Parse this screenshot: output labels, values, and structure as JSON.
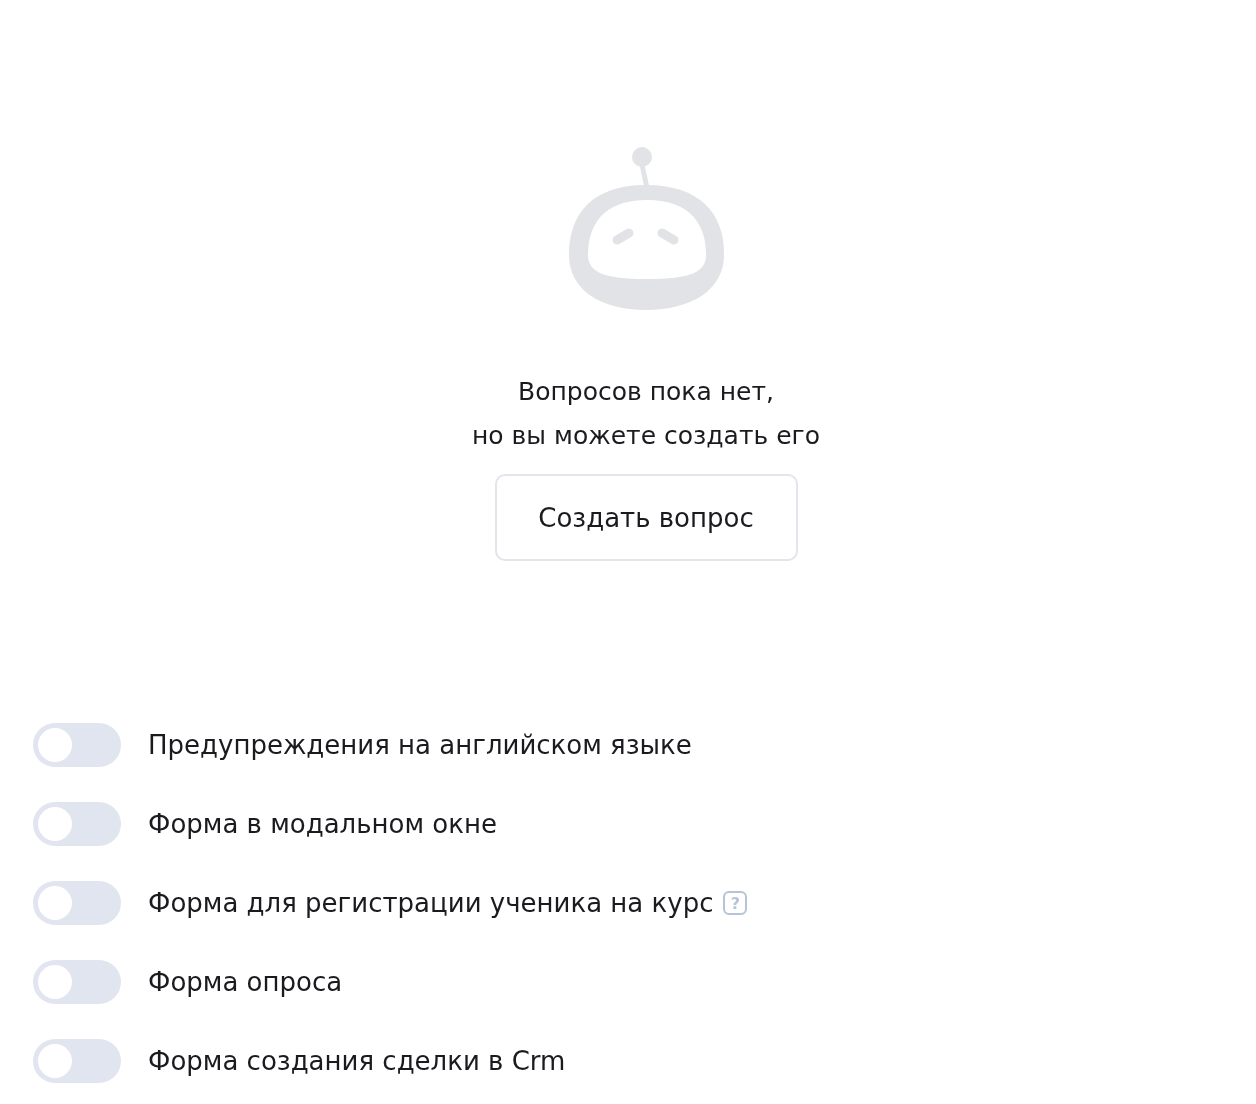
{
  "empty_state": {
    "message_lines": [
      "Вопросов пока нет,",
      "но вы можете создать его"
    ],
    "button": "Создать вопрос"
  },
  "settings": [
    {
      "label": "Предупреждения на английском языке",
      "on": false
    },
    {
      "label": "Форма в модальном окне",
      "on": false
    },
    {
      "label": "Форма для регистрации ученика на курс",
      "on": false,
      "hint": "?"
    },
    {
      "label": "Форма опроса",
      "on": false
    },
    {
      "label": "Форма создания сделки в Crm",
      "on": false
    }
  ]
}
